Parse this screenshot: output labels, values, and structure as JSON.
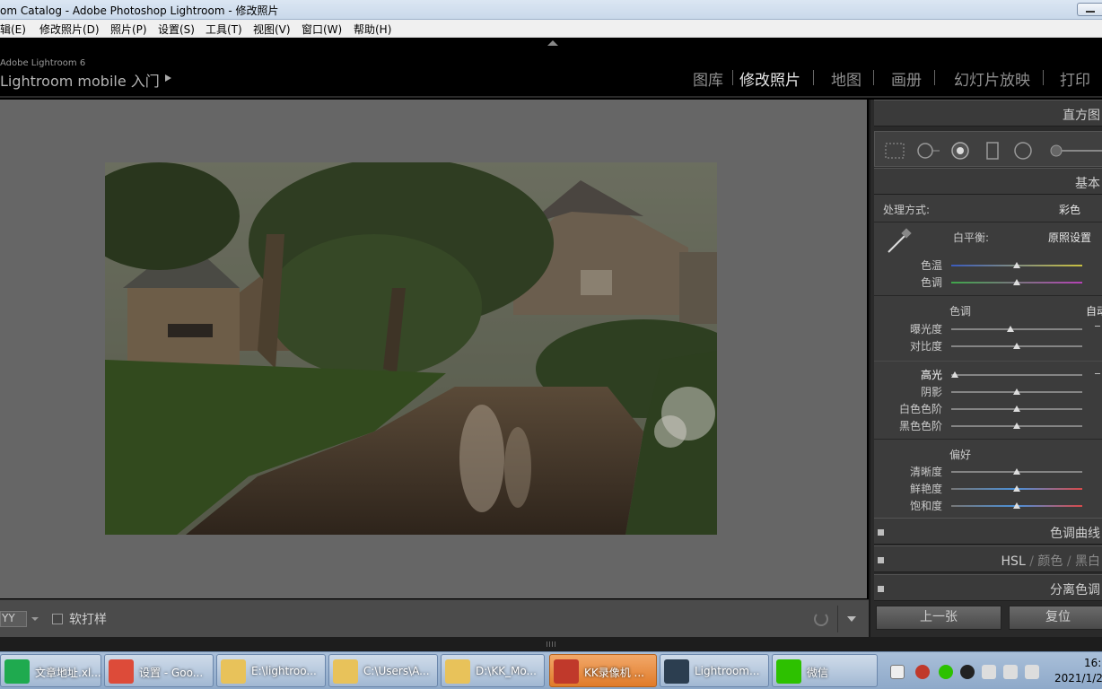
{
  "window": {
    "title": "om Catalog - Adobe Photoshop Lightroom - 修改照片"
  },
  "menu": [
    "辑(E)",
    "修改照片(D)",
    "照片(P)",
    "设置(S)",
    "工具(T)",
    "视图(V)",
    "窗口(W)",
    "帮助(H)"
  ],
  "identity": {
    "brand": "Adobe Lightroom 6",
    "mobile": "Lightroom mobile 入门"
  },
  "modules": [
    "图库",
    "修改照片",
    "地图",
    "画册",
    "幻灯片放映",
    "打印"
  ],
  "active_module": "修改照片",
  "toolbar": {
    "view_mode": "YY",
    "softproof": "软打样"
  },
  "right_panel": {
    "histogram_header": "直方图",
    "basic_header": "基本",
    "treatment_label": "处理方式:",
    "treatment_value": "彩色",
    "wb_label": "白平衡:",
    "wb_value": "原照设置",
    "temp_label": "色温",
    "tint_label": "色调",
    "tone_title": "色调",
    "auto_label": "自动",
    "tone_sliders": [
      {
        "label": "曝光度",
        "value": 0.45
      },
      {
        "label": "对比度",
        "value": 0.5
      }
    ],
    "tone_sliders2": [
      {
        "label": "高光",
        "value": 0.03
      },
      {
        "label": "阴影",
        "value": 0.5
      },
      {
        "label": "白色色阶",
        "value": 0.5
      },
      {
        "label": "黑色色阶",
        "value": 0.5
      }
    ],
    "presence_title": "偏好",
    "presence_sliders": [
      {
        "label": "清晰度",
        "value": 0.5
      },
      {
        "label": "鲜艳度",
        "value": 0.5
      },
      {
        "label": "饱和度",
        "value": 0.5
      }
    ],
    "wb_sliders": [
      {
        "label": "色温",
        "value": 0.5
      },
      {
        "label": "色调",
        "value": 0.5
      }
    ],
    "tone_curve_header": "色调曲线",
    "hsl_header": {
      "a": "HSL",
      "b": "颜色",
      "c": "黑白"
    },
    "split_header": "分离色调",
    "prev_button": "上一张",
    "reset_button": "复位"
  },
  "taskbar": {
    "items": [
      {
        "label": "文章地址.xl...",
        "icon": "wps-icon",
        "color": "#1faa4f"
      },
      {
        "label": "设置 - Goo...",
        "icon": "chrome-icon",
        "color": "#dd4b39"
      },
      {
        "label": "E:\\lightroo...",
        "icon": "folder-icon",
        "color": "#e8c25a"
      },
      {
        "label": "C:\\Users\\A...",
        "icon": "folder-icon",
        "color": "#e8c25a"
      },
      {
        "label": "D:\\KK_Mo...",
        "icon": "folder-icon",
        "color": "#e8c25a"
      },
      {
        "label": "KK录像机 ...",
        "icon": "kk-recorder-icon",
        "color": "#c0392b"
      },
      {
        "label": "Lightroom...",
        "icon": "lightroom-icon",
        "color": "#2c3e50"
      },
      {
        "label": "微信",
        "icon": "wechat-icon",
        "color": "#2dc100"
      }
    ],
    "clock_time": "16:",
    "clock_date": "2021/1/2"
  }
}
